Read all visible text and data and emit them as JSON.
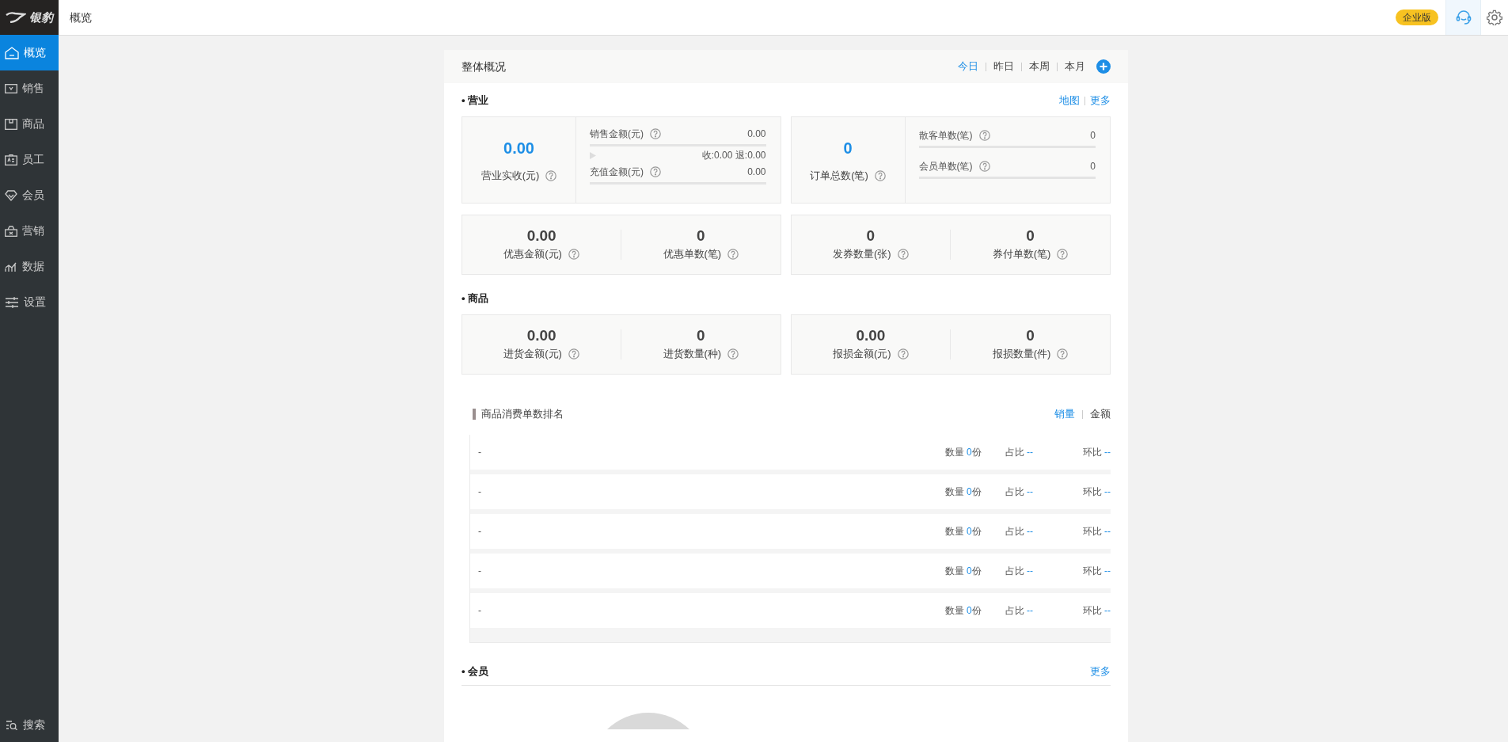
{
  "sidebar": {
    "logo": "银豹",
    "items": [
      {
        "label": "概览",
        "selected": true
      },
      {
        "label": "销售",
        "selected": false
      },
      {
        "label": "商品",
        "selected": false
      },
      {
        "label": "员工",
        "selected": false
      },
      {
        "label": "会员",
        "selected": false
      },
      {
        "label": "营销",
        "selected": false
      },
      {
        "label": "数据",
        "selected": false
      },
      {
        "label": "设置",
        "selected": false
      }
    ],
    "search": "搜索"
  },
  "topbar": {
    "title": "概览",
    "badge": "企业版"
  },
  "overview": {
    "title": "整体概况",
    "periods": [
      {
        "label": "今日",
        "selected": true
      },
      {
        "label": "昨日",
        "selected": false
      },
      {
        "label": "本周",
        "selected": false
      },
      {
        "label": "本月",
        "selected": false
      }
    ]
  },
  "business": {
    "title": "• 营业",
    "links": [
      "地图",
      "更多"
    ],
    "revenue": {
      "value": "0.00",
      "label": "营业实收(元)",
      "sales": {
        "label": "销售金额(元)",
        "value": "0.00",
        "level": 0
      },
      "sales_detail": "收:0.00 退:0.00",
      "recharge": {
        "label": "充值金额(元)",
        "value": "0.00",
        "level": 0
      }
    },
    "orders": {
      "value": "0",
      "label": "订单总数(笔)",
      "items": [
        {
          "label": "散客单数(笔)",
          "value": "0",
          "level": 0
        },
        {
          "label": "会员单数(笔)",
          "value": "0",
          "level": 0
        }
      ]
    },
    "stat_groups": [
      [
        {
          "value": "0.00",
          "label": "优惠金额(元)"
        },
        {
          "value": "0",
          "label": "优惠单数(笔)"
        }
      ],
      [
        {
          "value": "0",
          "label": "发券数量(张)"
        },
        {
          "value": "0",
          "label": "券付单数(笔)"
        }
      ]
    ]
  },
  "products": {
    "title": "• 商品",
    "stat_groups": [
      [
        {
          "value": "0.00",
          "label": "进货金额(元)"
        },
        {
          "value": "0",
          "label": "进货数量(种)"
        }
      ],
      [
        {
          "value": "0.00",
          "label": "报损金额(元)"
        },
        {
          "value": "0",
          "label": "报损数量(件)"
        }
      ]
    ]
  },
  "ranking": {
    "title": "商品消费单数排名",
    "tabs": [
      {
        "label": "销量",
        "selected": true
      },
      {
        "label": "金额",
        "selected": false
      }
    ],
    "rows": [
      {
        "name": "-",
        "qty_label": "数量",
        "qty": "0",
        "unit": "份",
        "share_label": "占比",
        "share": "--",
        "change_label": "环比",
        "change": "--"
      },
      {
        "name": "-",
        "qty_label": "数量",
        "qty": "0",
        "unit": "份",
        "share_label": "占比",
        "share": "--",
        "change_label": "环比",
        "change": "--"
      },
      {
        "name": "-",
        "qty_label": "数量",
        "qty": "0",
        "unit": "份",
        "share_label": "占比",
        "share": "--",
        "change_label": "环比",
        "change": "--"
      },
      {
        "name": "-",
        "qty_label": "数量",
        "qty": "0",
        "unit": "份",
        "share_label": "占比",
        "share": "--",
        "change_label": "环比",
        "change": "--"
      },
      {
        "name": "-",
        "qty_label": "数量",
        "qty": "0",
        "unit": "份",
        "share_label": "占比",
        "share": "--",
        "change_label": "环比",
        "change": "--"
      }
    ]
  },
  "members": {
    "title": "• 会员",
    "link": "更多"
  }
}
